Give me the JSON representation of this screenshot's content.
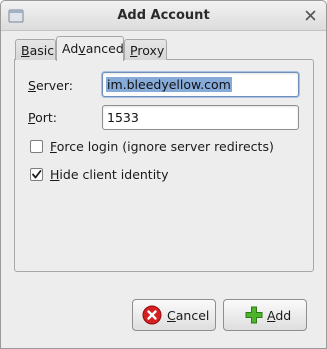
{
  "window": {
    "title": "Add Account",
    "icon": "app-window-icon",
    "close_icon": "close-icon"
  },
  "tabs": [
    {
      "label_pre": "",
      "label_ul": "B",
      "label_post": "asic",
      "active": false
    },
    {
      "label_pre": "Ad",
      "label_ul": "v",
      "label_post": "anced",
      "active": true
    },
    {
      "label_pre": "",
      "label_ul": "P",
      "label_post": "roxy",
      "active": false
    }
  ],
  "advanced": {
    "server": {
      "label_ul": "S",
      "label_post": "erver:",
      "value": "im.bleedyellow.com",
      "selected": true
    },
    "port": {
      "label_ul": "P",
      "label_post": "ort:",
      "value": "1533"
    },
    "force_login": {
      "label_ul": "F",
      "label_post": "orce login (ignore server redirects)",
      "checked": false
    },
    "hide_identity": {
      "label_ul": "H",
      "label_post": "ide client identity",
      "checked": true
    }
  },
  "buttons": {
    "cancel": {
      "label_ul": "C",
      "label_post": "ancel",
      "icon": "cancel-icon",
      "color": "#d42020"
    },
    "add": {
      "label_ul": "A",
      "label_post": "dd",
      "icon": "add-icon",
      "color": "#3a9a1f"
    }
  }
}
